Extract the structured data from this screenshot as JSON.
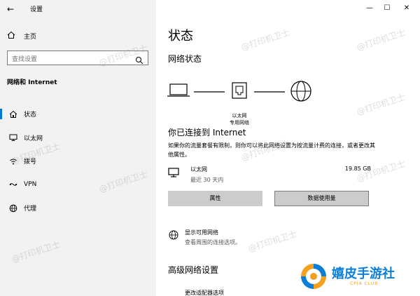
{
  "window": {
    "title": "设置",
    "back_glyph": "←",
    "minimize_glyph": "—",
    "maximize_glyph": "☐",
    "close_glyph": "✕"
  },
  "sidebar": {
    "home_label": "主页",
    "search_placeholder": "查找设置",
    "section_title": "网络和 Internet",
    "items": [
      {
        "label": "状态",
        "icon": "home-network-icon",
        "active": true
      },
      {
        "label": "以太网",
        "icon": "ethernet-monitor-icon",
        "active": false
      },
      {
        "label": "拨号",
        "icon": "dialup-icon",
        "active": false
      },
      {
        "label": "VPN",
        "icon": "vpn-icon",
        "active": false
      },
      {
        "label": "代理",
        "icon": "globe-icon",
        "active": false
      }
    ]
  },
  "main": {
    "page_title": "状态",
    "network_status_heading": "网络状态",
    "diagram_caption_line1": "以太网",
    "diagram_caption_line2": "专用网络",
    "connected_title": "你已连接到 Internet",
    "connected_desc": "如果你的流量套餐有限制，则你可以将此网络设置为按流量计费的连接，或者更改其他属性。",
    "ethernet": {
      "name": "以太网",
      "period": "最近 30 天内",
      "usage": "19.85 GB"
    },
    "buttons": {
      "properties": "属性",
      "data_usage": "数据使用量"
    },
    "available_networks": {
      "title": "显示可用网络",
      "desc": "查看周围的连接选项。"
    },
    "advanced_heading": "高级网络设置",
    "advanced_partial": "更改适配器选项"
  },
  "watermark_text": "@打印机卫士",
  "logo": {
    "brand": "嬉皮手游社",
    "sub": "CPIA CLUB"
  },
  "colors": {
    "accent": "#0078d7",
    "sidebar_bg": "#f2f2f2",
    "button_bg": "#cccccc",
    "logo_blue": "#0b7fd8",
    "logo_orange": "#f2a01e"
  }
}
